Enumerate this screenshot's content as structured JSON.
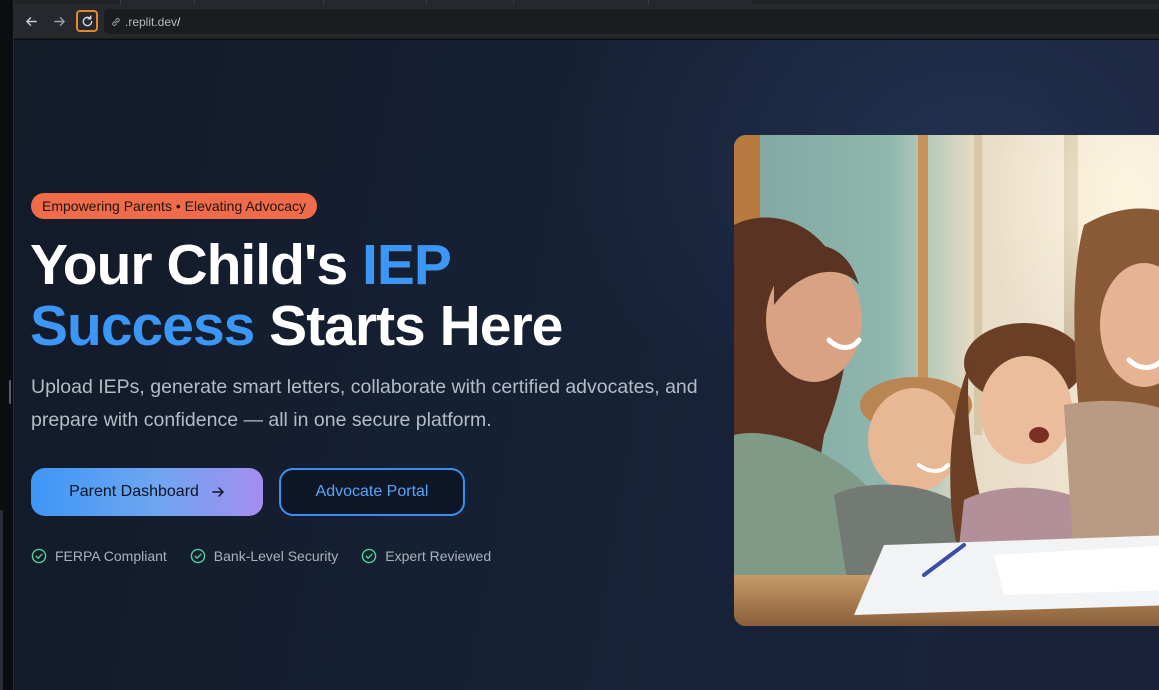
{
  "browser": {
    "url": ".replit.dev/",
    "url_text": ".replit.dev",
    "url_caret": "/"
  },
  "hero": {
    "badge": "Empowering Parents • Elevating Advocacy",
    "headline": {
      "part1": "Your Child's ",
      "accent1": "IEP",
      "accent2": "Success",
      "part2": " Starts Here"
    },
    "subtitle": "Upload IEPs, generate smart letters, collaborate with certified advocates, and prepare with confidence — all in one secure platform.",
    "buttons": {
      "primary": "Parent Dashboard",
      "secondary": "Advocate Portal"
    },
    "trust": [
      "FERPA Compliant",
      "Bank-Level Security",
      "Expert Reviewed"
    ],
    "image_alt": ""
  },
  "colors": {
    "accent_blue": "#3b96f5",
    "badge_bg": "#f06b4a",
    "check_green": "#4fd39a",
    "hero_bg": "#152033"
  },
  "icons": {
    "back": "arrow-left-icon",
    "forward": "arrow-right-icon",
    "reload": "reload-icon",
    "url": "link-icon",
    "button_arrow": "arrow-right-icon",
    "trust": "check-circle-icon"
  }
}
